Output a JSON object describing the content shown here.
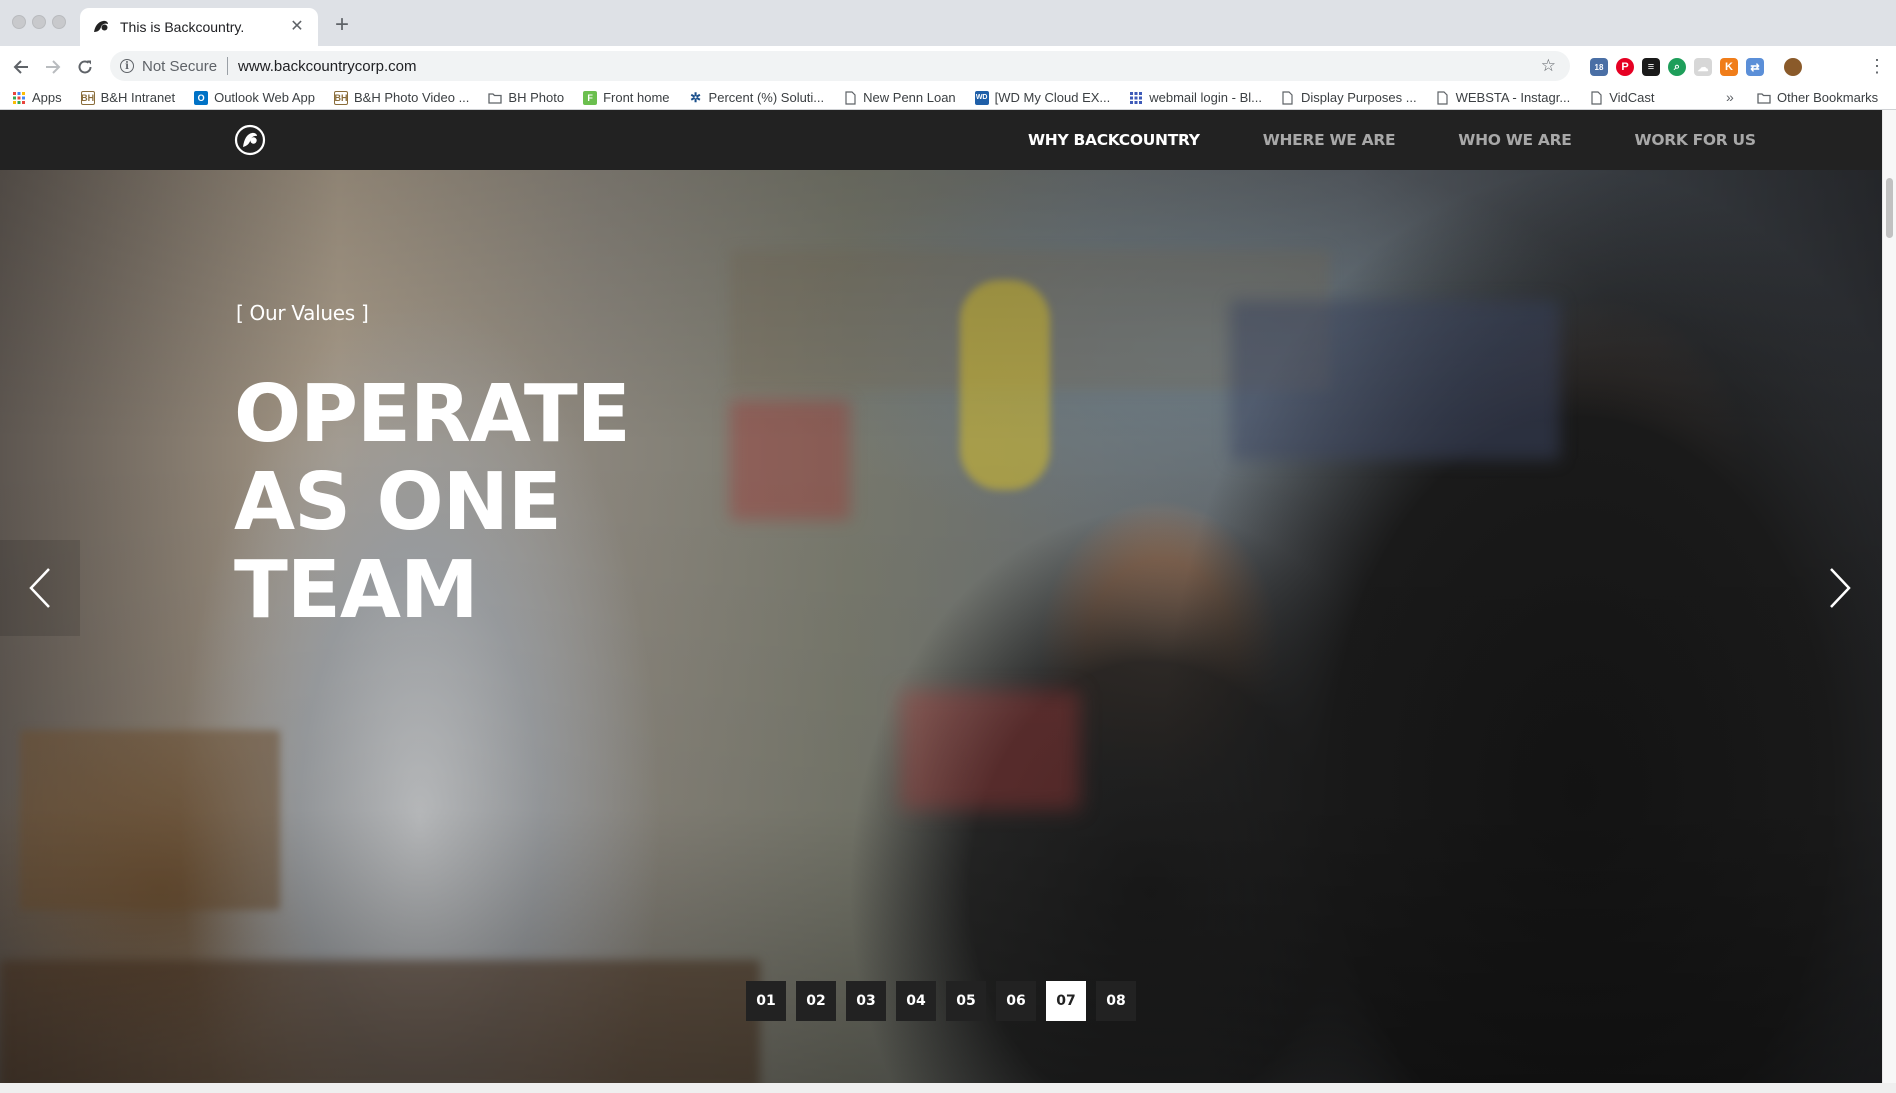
{
  "browser": {
    "tab_title": "This is Backcountry.",
    "security_label": "Not Secure",
    "url": "www.backcountrycorp.com",
    "bookmarks": [
      {
        "label": "Apps",
        "icon": "apps-grid-icon"
      },
      {
        "label": "B&H Intranet",
        "icon": "bh-icon"
      },
      {
        "label": "Outlook Web App",
        "icon": "outlook-icon"
      },
      {
        "label": "B&H Photo Video ...",
        "icon": "bh-icon"
      },
      {
        "label": "BH Photo",
        "icon": "folder-icon"
      },
      {
        "label": "Front home",
        "icon": "front-icon"
      },
      {
        "label": "Percent (%) Soluti...",
        "icon": "gear-icon"
      },
      {
        "label": "New Penn Loan",
        "icon": "page-icon"
      },
      {
        "label": "[WD My Cloud EX...",
        "icon": "wd-icon"
      },
      {
        "label": "webmail login - Bl...",
        "icon": "grid-icon"
      },
      {
        "label": "Display Purposes ...",
        "icon": "page-icon"
      },
      {
        "label": "WEBSTA - Instagr...",
        "icon": "page-icon"
      },
      {
        "label": "VidCast",
        "icon": "page-icon"
      }
    ],
    "other_bookmarks": "Other Bookmarks",
    "overflow_label": "»",
    "extension_badge": "18"
  },
  "site": {
    "nav": [
      {
        "label": "WHY BACKCOUNTRY",
        "active": true
      },
      {
        "label": "WHERE WE ARE",
        "active": false
      },
      {
        "label": "WHO WE ARE",
        "active": false
      },
      {
        "label": "WORK FOR US",
        "active": false
      }
    ],
    "hero": {
      "kicker": "[ Our Values ]",
      "title": "OPERATE AS ONE TEAM",
      "slides": [
        "01",
        "02",
        "03",
        "04",
        "05",
        "06",
        "07",
        "08"
      ],
      "active_slide": "07"
    }
  }
}
